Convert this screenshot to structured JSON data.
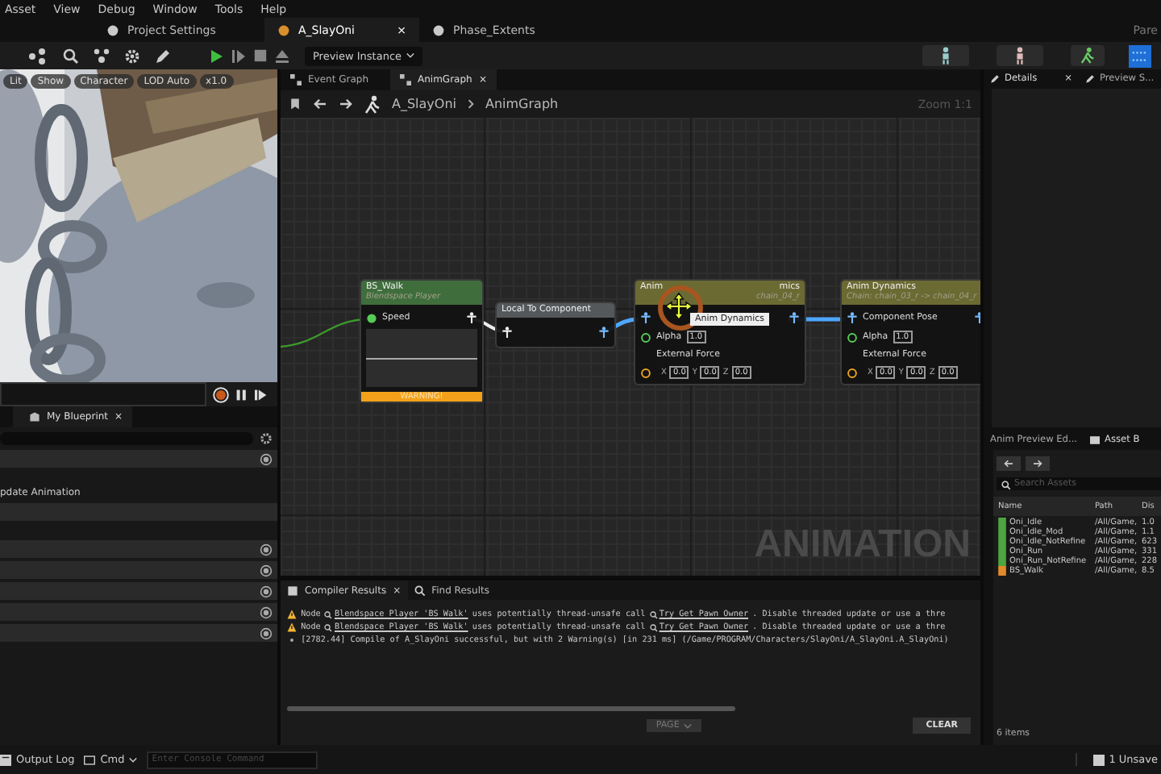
{
  "menu": [
    "Asset",
    "View",
    "Debug",
    "Window",
    "Tools",
    "Help"
  ],
  "doc_tabs": [
    {
      "label": "Project Settings",
      "selected": false
    },
    {
      "label": "A_SlayOni",
      "selected": true,
      "close": "×"
    },
    {
      "label": "Phase_Extents",
      "selected": false
    }
  ],
  "doc_tabs_right": "Pare",
  "toolbar": {
    "preview_instance": "Preview Instance"
  },
  "viewport": {
    "chips": [
      "Lit",
      "Show",
      "Character",
      "LOD Auto",
      "x1.0"
    ]
  },
  "my_blueprint": {
    "tab": "My Blueprint",
    "close": "×",
    "rows": [
      {
        "kind": "search"
      },
      {
        "kind": "bar"
      },
      {
        "kind": "blank"
      },
      {
        "kind": "text",
        "label": "pdate Animation"
      },
      {
        "kind": "plain"
      },
      {
        "kind": "blank"
      },
      {
        "kind": "bar"
      },
      {
        "kind": "bar"
      },
      {
        "kind": "bar"
      },
      {
        "kind": "bar"
      },
      {
        "kind": "bar"
      }
    ]
  },
  "graph": {
    "tabs": [
      {
        "label": "Event Graph",
        "selected": false
      },
      {
        "label": "AnimGraph",
        "selected": true
      }
    ],
    "close": "×",
    "breadcrumb": [
      "A_SlayOni",
      "AnimGraph"
    ],
    "zoom": "Zoom 1:1",
    "watermark": "ANIMATION",
    "tooltip": "Anim Dynamics",
    "nodes": [
      {
        "kind": "player",
        "title": "BS_Walk",
        "subtitle": "Blendspace Player",
        "color": "#3f6e3c",
        "pin": "Speed",
        "warning": "WARNING!"
      },
      {
        "kind": "convert",
        "title": "Local To Component",
        "color": "#55585b"
      },
      {
        "kind": "dynamics",
        "title": "Anim",
        "title_end": "mics",
        "subtitle_end": "chain_04_r",
        "color": "#6b6a33",
        "alpha_label": "Alpha",
        "alpha": "1.0",
        "force": "External Force",
        "axes": [
          "X",
          "Y",
          "Z"
        ],
        "xyz": [
          "0.0",
          "0.0",
          "0.0"
        ]
      },
      {
        "kind": "dynamics",
        "title": "Anim Dynamics",
        "subtitle": "Chain: chain_03_r -> chain_04_r",
        "color": "#6b6a33",
        "pose": "Component Pose",
        "alpha_label": "Alpha",
        "alpha": "1.0",
        "force": "External Force",
        "axes": [
          "X",
          "Y",
          "Z"
        ],
        "xyz": [
          "0.0",
          "0.0",
          "0.0"
        ]
      }
    ]
  },
  "compiler": {
    "tabs": [
      {
        "label": "Compiler Results",
        "selected": true
      },
      {
        "label": "Find Results",
        "selected": false
      }
    ],
    "close": "×",
    "messages": [
      {
        "kind": "warning",
        "node": "Node",
        "link1": "Blendspace Player 'BS_Walk'",
        "mid": "uses potentially thread-unsafe call",
        "link2": "Try Get Pawn Owner",
        "end": ". Disable threaded update or use a thre"
      },
      {
        "kind": "warning",
        "node": "Node",
        "link1": "Blendspace Player 'BS_Walk'",
        "mid": "uses potentially thread-unsafe call",
        "link2": "Try Get Pawn Owner",
        "end": ". Disable threaded update or use a thre"
      },
      {
        "kind": "info",
        "text": "[2782.44] Compile of A_SlayOni successful, but with 2 Warning(s) [in 231 ms] (/Game/PROGRAM/Characters/SlayOni/A_SlayOni.A_SlayOni)"
      }
    ],
    "page": "PAGE",
    "clear": "CLEAR"
  },
  "details": {
    "tabs": [
      {
        "label": "Details",
        "selected": true
      },
      {
        "label": "Preview S...",
        "selected": false
      }
    ],
    "close": "×"
  },
  "asset_browser": {
    "tabs": [
      {
        "label": "Anim Preview Ed...",
        "selected": false
      },
      {
        "label": "Asset B",
        "selected": true
      }
    ],
    "search": {
      "placeholder": "Search Assets"
    },
    "columns": [
      "Name",
      "Path",
      "Dis"
    ],
    "assets": [
      {
        "kind": "sequence",
        "name": "Oni_Idle",
        "path": "/All/Game,",
        "column_3": "1.0"
      },
      {
        "kind": "sequence",
        "name": "Oni_Idle_Mod",
        "path": "/All/Game,",
        "column_3": "1.1"
      },
      {
        "kind": "sequence",
        "name": "Oni_Idle_NotRefine",
        "path": "/All/Game,",
        "column_3": "623"
      },
      {
        "kind": "sequence",
        "name": "Oni_Run",
        "path": "/All/Game,",
        "column_3": "331"
      },
      {
        "kind": "sequence",
        "name": "Oni_Run_NotRefine",
        "path": "/All/Game,",
        "column_3": "228"
      },
      {
        "kind": "blendspace",
        "name": "BS_Walk",
        "path": "/All/Game,",
        "column_3": "8.5"
      }
    ],
    "count": "6 items"
  },
  "status_bar": {
    "output_log": "Output Log",
    "cmd": "Cmd",
    "console": {
      "placeholder": "Enter Console Command"
    },
    "unsaved": "1 Unsave"
  }
}
